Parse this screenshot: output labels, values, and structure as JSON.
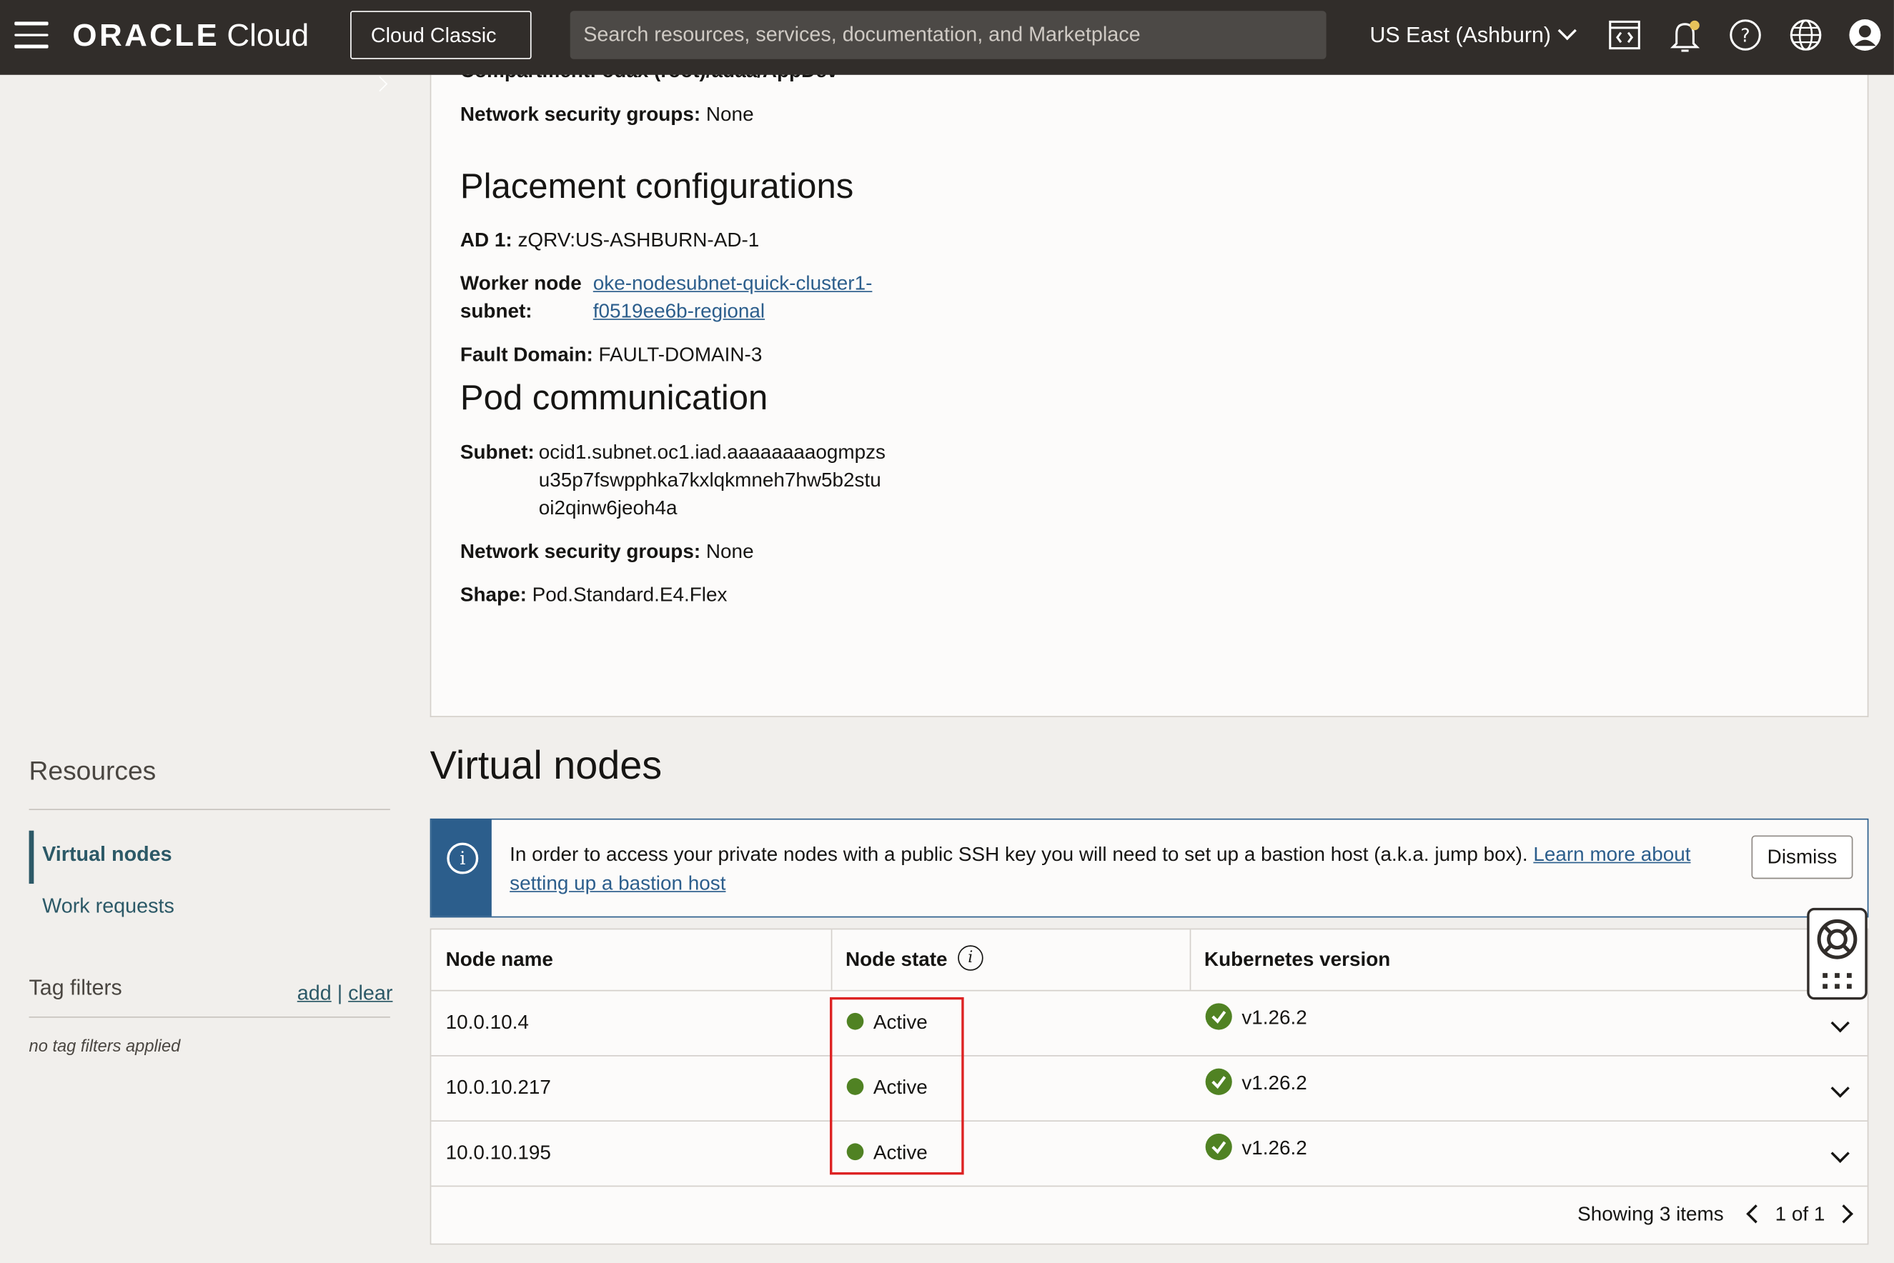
{
  "topbar": {
    "brand_main": "ORACLE",
    "brand_sub": "Cloud",
    "classic_label": "Cloud Classic",
    "search_placeholder": "Search resources, services, documentation, and Marketplace",
    "region_label": "US East (Ashburn)"
  },
  "details": {
    "partial_compartment": "Compartment: odax (root)/adaa/AppDev",
    "nsg1_label": "Network security groups:",
    "nsg1_value": "None",
    "placement_title": "Placement configurations",
    "ad_label": "AD 1:",
    "ad_value": "zQRV:US-ASHBURN-AD-1",
    "worker_label_1": "Worker node",
    "worker_label_2": "subnet:",
    "worker_link_1": "oke-nodesubnet-quick-cluster1-",
    "worker_link_2": "f0519ee6b-regional",
    "fault_label": "Fault Domain:",
    "fault_value": "FAULT-DOMAIN-3",
    "pod_title": "Pod communication",
    "subnet_label": "Subnet:",
    "subnet_line_1": "ocid1.subnet.oc1.iad.aaaaaaaaogmpzs",
    "subnet_line_2": "u35p7fswpphka7kxlqkmneh7hw5b2stu",
    "subnet_line_3": "oi2qinw6jeoh4a",
    "nsg2_label": "Network security groups:",
    "nsg2_value": "None",
    "shape_label": "Shape:",
    "shape_value": "Pod.Standard.E4.Flex"
  },
  "sidebar": {
    "resources_title": "Resources",
    "items": [
      {
        "label": "Virtual nodes"
      },
      {
        "label": "Work requests"
      }
    ],
    "tag_title": "Tag filters",
    "tag_add": "add",
    "tag_sep": "|",
    "tag_clear": "clear",
    "tag_empty": "no tag filters applied"
  },
  "virtual_nodes": {
    "title": "Virtual nodes",
    "banner_text": "In order to access your private nodes with a public SSH key you will need to set up a bastion host (a.k.a. jump box).",
    "banner_link_1": "Learn more about",
    "banner_link_2": "setting up a bastion host",
    "dismiss_label": "Dismiss",
    "columns": [
      "Node name",
      "Node state",
      "Kubernetes version"
    ],
    "rows": [
      {
        "name": "10.0.10.4",
        "state": "Active",
        "version": "v1.26.2"
      },
      {
        "name": "10.0.10.217",
        "state": "Active",
        "version": "v1.26.2"
      },
      {
        "name": "10.0.10.195",
        "state": "Active",
        "version": "v1.26.2"
      }
    ],
    "showing": "Showing 3 items",
    "page": "1 of 1"
  },
  "colors": {
    "topbar": "#312d2a",
    "accent_blue": "#2c5e8c",
    "status_green": "#508223",
    "highlight_red": "#dd2222"
  }
}
